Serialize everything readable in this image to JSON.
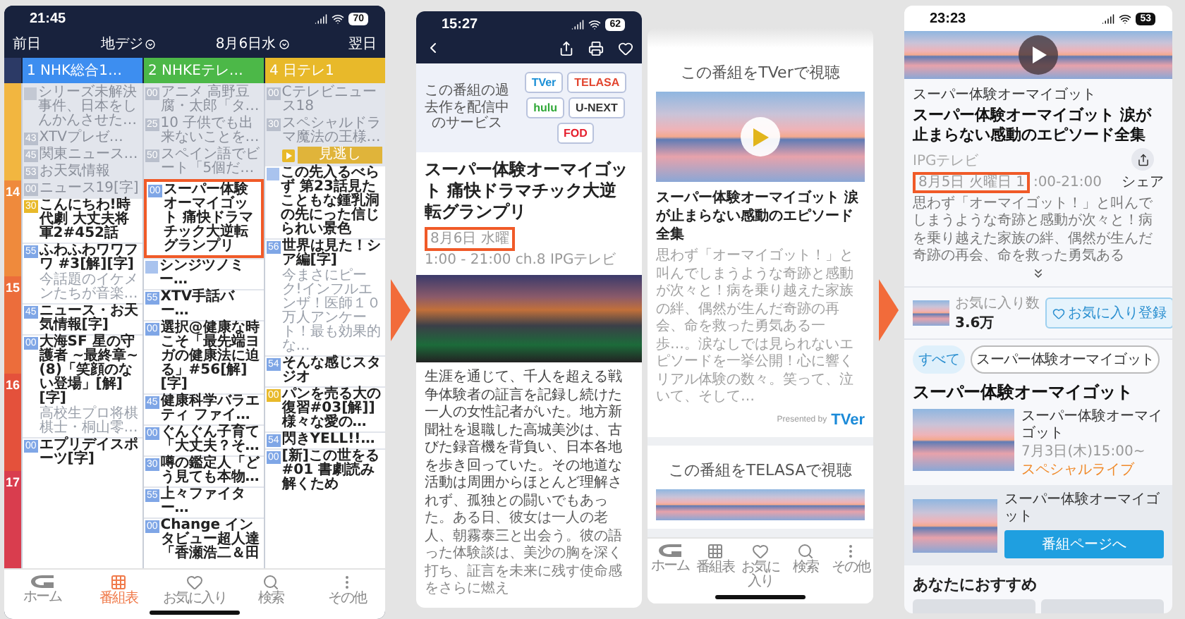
{
  "program_guide": {
    "status_bar": {
      "time": "21:45",
      "battery": "70"
    },
    "date_bar": {
      "previous": "前日",
      "broadcast": "地デジ",
      "date": "8月6日水",
      "next": "翌日"
    },
    "hours": [
      {
        "color": "#f2b640"
      },
      {
        "label": "14",
        "color": "#ef8a3c"
      },
      {
        "label": "15",
        "color": "#ec6d3b"
      },
      {
        "label": "16",
        "color": "#e4513b"
      },
      {
        "label": "17",
        "color": "#d93d4e"
      }
    ],
    "channels": [
      {
        "name": "1 NHK総合1…",
        "color": "#3d8ef0",
        "cells": [
          {
            "title": "シリーズ未解決事件、日本をしんかんさせた…",
            "past": true,
            "highlighted": false
          },
          {
            "minute": "43",
            "title": "XTVプレゼ…",
            "past": true,
            "highlighted": false
          },
          {
            "minute": "45",
            "title": "関東ニュース…",
            "past": true,
            "highlighted": false
          },
          {
            "minute": "53",
            "title": "お天気情報",
            "past": true,
            "highlighted": false
          },
          {
            "minute": "00",
            "title": "ニュース19[字]",
            "past": true,
            "highlighted": false
          },
          {
            "minute": "30",
            "title": "こんにちわ!時代劇 大丈夫将軍2#452話",
            "past": false,
            "highlighted": false,
            "color": "#e8b92a"
          },
          {
            "minute": "55",
            "title": "ふわふわワワフワ #3[解][字]",
            "sub": "今話題のイケメンたちが音楽…",
            "past": false,
            "highlighted": false
          },
          {
            "minute": "45",
            "title": "ニュース・お天気情報[字]",
            "past": false,
            "highlighted": false
          },
          {
            "minute": "00",
            "title": "大海SF 星の守護者 ~最終章~ (8)「笑顔のない登場」[解][字]",
            "sub": "高校生プロ将棋棋士・桐山零…",
            "past": false,
            "highlighted": false
          },
          {
            "minute": "00",
            "title": "エプリデイスポーツ[字]",
            "past": false,
            "highlighted": false
          }
        ]
      },
      {
        "name": "2 NHKEテレ…",
        "color": "#4cb848",
        "cells": [
          {
            "minute": "00",
            "title": "アニメ 高野豆腐・太郎「タ…",
            "past": true,
            "highlighted": false
          },
          {
            "minute": "25",
            "title": "10 子供でも出来ないことを…",
            "past": true,
            "highlighted": false
          },
          {
            "minute": "50",
            "title": "スペイン語でビート「5個だ…",
            "past": true,
            "highlighted": false
          },
          {
            "minute": "00",
            "title": "スーパー体験オーマイゴット 痛快ドラマチック大逆転グランプリ",
            "past": false,
            "highlighted": true
          },
          {
            "title": "シンジツノミー…",
            "past": false,
            "highlighted": false
          },
          {
            "minute": "55",
            "title": "XTV手話バー…",
            "past": false,
            "highlighted": false
          },
          {
            "minute": "00",
            "title": "選択@健康な時こそ「最先端ヨガの健康法に迫る」#56[解][字]",
            "past": false,
            "highlighted": false
          },
          {
            "minute": "45",
            "title": "健康科学バラエティ ファイ…",
            "past": false,
            "highlighted": false
          },
          {
            "minute": "00",
            "title": "ぐんぐん子育て「大丈夫？そ…",
            "past": false,
            "highlighted": false
          },
          {
            "minute": "30",
            "title": "噂の鑑定人「どう見ても本物…",
            "past": false,
            "highlighted": false
          },
          {
            "minute": "55",
            "title": "上々ファイター…",
            "past": false,
            "highlighted": false
          },
          {
            "minute": "00",
            "title": "Change インタビュー超人達「香瀬浩二＆田",
            "past": false,
            "highlighted": false
          }
        ]
      },
      {
        "name": "4 日テレ1",
        "color": "#e8b92a",
        "cells": [
          {
            "minute": "00",
            "title": "Cテレビニュース18",
            "past": true,
            "highlighted": false
          },
          {
            "minute": "30",
            "title": "スペシャルドラマ魔法の王様…",
            "catchup": "見逃し",
            "past": true,
            "highlighted": false
          },
          {
            "title": "この先入るべらず 第23話見たこともな鍾乳洞の先にった信じられい景色",
            "past": false,
            "highlighted": false
          },
          {
            "minute": "56",
            "title": "世界は見た！シア編[字]",
            "sub": "今まさにピーク!インフルエンザ！医師１０万人アンケート！最も効果的な…",
            "past": false,
            "highlighted": false
          },
          {
            "minute": "54",
            "title": "そんな感じスタジオ",
            "past": false,
            "highlighted": false
          },
          {
            "minute": "00",
            "title": "パンを売る大の復習#03[解]] 様々な愛の…",
            "past": false,
            "highlighted": false,
            "color": "#e8b92a"
          },
          {
            "minute": "54",
            "title": "閃きYELL!!…",
            "past": false,
            "highlighted": false
          },
          {
            "minute": "00",
            "title": "[新]この世をる #01 書劇読み解くため",
            "past": false,
            "highlighted": false
          }
        ]
      }
    ],
    "tabs": [
      {
        "kind": "home",
        "label": "ホーム",
        "selected": false
      },
      {
        "kind": "guide",
        "label": "番組表",
        "selected": true
      },
      {
        "kind": "favorites",
        "label": "お気に入り",
        "selected": false
      },
      {
        "kind": "search",
        "label": "検索",
        "selected": false
      },
      {
        "kind": "more",
        "label": "その他",
        "selected": false
      }
    ]
  },
  "program_detail": {
    "status_bar": {
      "time": "15:27",
      "battery": "62"
    },
    "services": {
      "caption": "この番組の過去作を配信中のサービス",
      "logos": [
        {
          "name": "TVer",
          "color": "#1a8fd6"
        },
        {
          "name": "TELASA",
          "color": "#e2452f"
        },
        {
          "name": "hulu",
          "color": "#2fa836"
        },
        {
          "name": "U-NEXT",
          "color": "#333333"
        },
        {
          "name": "FOD",
          "color": "#e5202e"
        }
      ]
    },
    "title": "スーパー体験オーマイゴット 痛快ドラマチック大逆転グランプリ",
    "date": "8月6日 水曜",
    "date_highlighted": true,
    "schedule": "1:00 - 21:00 ch.8 IPGテレビ",
    "description": "生涯を通じて、千人を超える戦争体験者の証言を記録し続けた一人の女性記者がいた。地方新聞社を退職した高城美沙は、古びた録音機を背負い、日本各地を歩き回っていた。その地道な活動は周囲からほとんど理解されず、孤独との闘いでもあった。ある日、彼女は一人の老人、朝霧泰三と出会う。彼の語った体験談は、美沙の胸を深く打ち、証言を未来に残す使命感をさらに燃え"
  },
  "streaming_options": {
    "sections": [
      {
        "heading": "この番組をTVerで視聴",
        "episode_title": "スーパー体験オーマイゴット 涙が止まらない感動のエピソード全集",
        "description": "思わず「オーマイゴット！」と叫んでしまうような奇跡と感動が次々と！病を乗り越えた家族の絆、偶然が生んだ奇跡の再会、命を救った勇気ある一歩…。涙なしでは見られないエピソードを一挙公開！心に響くリアル体験の数々。笑って、泣いて、そして…",
        "credit": "Presented by",
        "provider": "TVer"
      },
      {
        "heading": "この番組をTELASAで視聴"
      }
    ],
    "tabs": [
      {
        "kind": "home",
        "label": "ホーム",
        "selected": false
      },
      {
        "kind": "guide",
        "label": "番組表",
        "selected": false
      },
      {
        "kind": "favorites",
        "label": "お気に入り",
        "selected": false
      },
      {
        "kind": "search",
        "label": "検索",
        "selected": false
      },
      {
        "kind": "more",
        "label": "その他",
        "selected": false
      }
    ]
  },
  "episode_page": {
    "status_bar": {
      "time": "23:23",
      "battery": "53"
    },
    "series": "スーパー体験オーマイゴット",
    "title": "スーパー体験オーマイゴット 涙が止まらない感動のエピソード全集",
    "channel": "IPGテレビ",
    "date": "8月5日 火曜日 1",
    "date_highlighted": true,
    "time": ":00-21:00",
    "share": "シェア",
    "description": "思わず「オーマイゴット！」と叫んでしまうような奇跡と感動が次々と！病を乗り越えた家族の絆、偶然が生んだ奇跡の再会、命を救った勇気ある",
    "favorites": {
      "label": "お気に入り数",
      "count": "3.6万",
      "button": "お気に入り登録"
    },
    "filters": [
      {
        "label": "すべて",
        "selected": true
      },
      {
        "label": "スーパー体験オーマイゴット",
        "selected": false
      }
    ],
    "section_title": "スーパー体験オーマイゴット",
    "event": {
      "title": "スーパー体験オーマイゴット",
      "date": "7月3日(木)15:00~",
      "tag": "スペシャルライブ"
    },
    "program_link": {
      "title": "スーパー体験オーマイゴット",
      "button": "番組ページへ"
    },
    "recommendations_title": "あなたにおすすめ"
  }
}
